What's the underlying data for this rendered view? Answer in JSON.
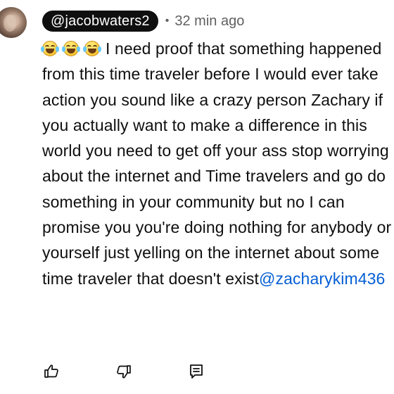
{
  "comment": {
    "author": {
      "handle": "@jacobwaters2"
    },
    "meta": {
      "separator": "•",
      "time_ago": "32 min ago"
    },
    "reactions": {
      "emojis": [
        "face-with-tears-of-joy",
        "face-with-tears-of-joy",
        "face-with-tears-of-joy"
      ]
    },
    "text": "I need proof that something happened from this time traveler before I would ever take action you sound like a crazy person Zachary if you actually want to make a difference in this world you need to get off your ass stop worrying about the internet and Time travelers and go do something in your community but no I can promise you you're doing nothing for anybody or yourself just yelling on the internet about some time traveler that doesn't exist",
    "mention": "@zacharykim436"
  },
  "actions": [
    {
      "name": "like-button",
      "icon": "thumbs-up-icon"
    },
    {
      "name": "dislike-button",
      "icon": "thumbs-down-icon"
    },
    {
      "name": "reply-button",
      "icon": "reply-comment-icon"
    }
  ],
  "colors": {
    "text": "#0f0f0f",
    "secondary_text": "#606060",
    "mention": "#065fd4",
    "handle_pill": "#0f0f0f"
  }
}
